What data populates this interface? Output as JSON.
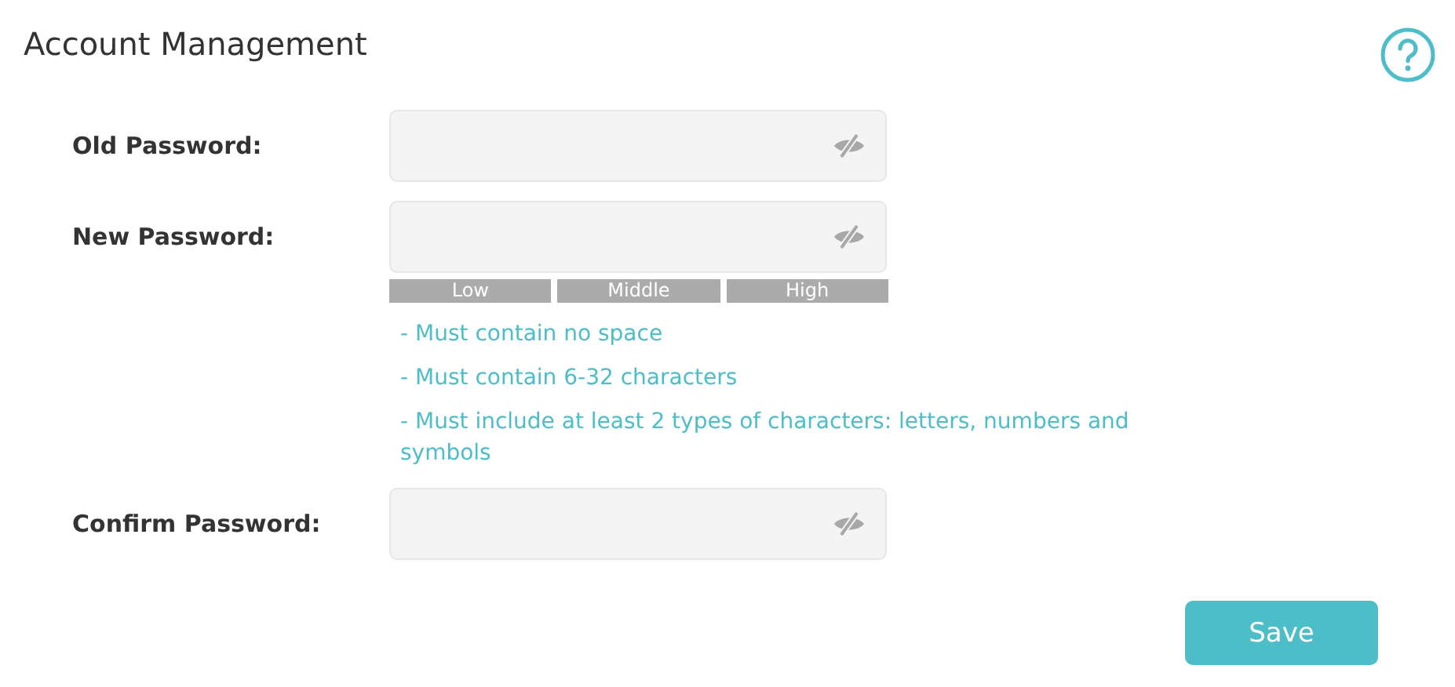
{
  "title": "Account Management",
  "fields": [
    {
      "label": "Old Password:"
    },
    {
      "label": "New Password:",
      "strength": [
        "Low",
        "Middle",
        "High"
      ],
      "rules": [
        "- Must contain no space",
        "- Must contain 6-32 characters",
        "- Must include at least 2 types of characters: letters, numbers and symbols"
      ]
    },
    {
      "label": "Confirm Password:"
    }
  ],
  "save_button": "Save"
}
